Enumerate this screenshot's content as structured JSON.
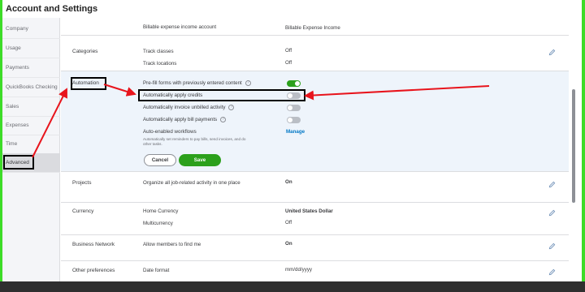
{
  "window": {
    "title": "Account and Settings"
  },
  "sidebar": {
    "items": [
      {
        "label": "Company"
      },
      {
        "label": "Usage"
      },
      {
        "label": "Payments"
      },
      {
        "label": "QuickBooks Checking"
      },
      {
        "label": "Sales"
      },
      {
        "label": "Expenses"
      },
      {
        "label": "Time"
      },
      {
        "label": "Advanced"
      }
    ]
  },
  "billable": {
    "label": "Billable expense income account",
    "value": "Billable Expense Income"
  },
  "categories": {
    "title": "Categories",
    "track_classes_label": "Track classes",
    "track_classes_value": "Off",
    "track_locations_label": "Track locations",
    "track_locations_value": "Off"
  },
  "automation": {
    "title": "Automation",
    "prefill_label": "Pre-fill forms with previously entered content",
    "apply_credits_label": "Automatically apply credits",
    "invoice_unbilled_label": "Automatically invoice unbilled activity",
    "bill_payments_label": "Automatically apply bill payments",
    "workflows_label": "Auto-enabled workflows",
    "workflows_desc": "Automatically set reminders to pay bills, send invoices, and do other tasks.",
    "manage_link": "Manage",
    "cancel_label": "Cancel",
    "save_label": "Save",
    "help_glyph": "?"
  },
  "projects": {
    "title": "Projects",
    "label": "Organize all job-related activity in one place",
    "value": "On"
  },
  "currency": {
    "title": "Currency",
    "home_label": "Home Currency",
    "home_value": "United States Dollar",
    "multi_label": "Multicurrency",
    "multi_value": "Off"
  },
  "business_network": {
    "title": "Business Network",
    "label": "Allow members to find me",
    "value": "On"
  },
  "other_preferences": {
    "title": "Other preferences",
    "date_format_label": "Date format",
    "date_format_value": "mm/dd/yyyy"
  },
  "toggles": {
    "prefill": true,
    "apply_credits": false,
    "invoice_unbilled": false,
    "bill_payments": false
  },
  "colors": {
    "highlight_border": "#3ddc28",
    "annotation_arrow": "#e8141c",
    "toggle_on": "#2ca01c",
    "link": "#0077c5"
  },
  "icons": {
    "edit": "pencil-icon",
    "help": "question-circle-icon"
  }
}
